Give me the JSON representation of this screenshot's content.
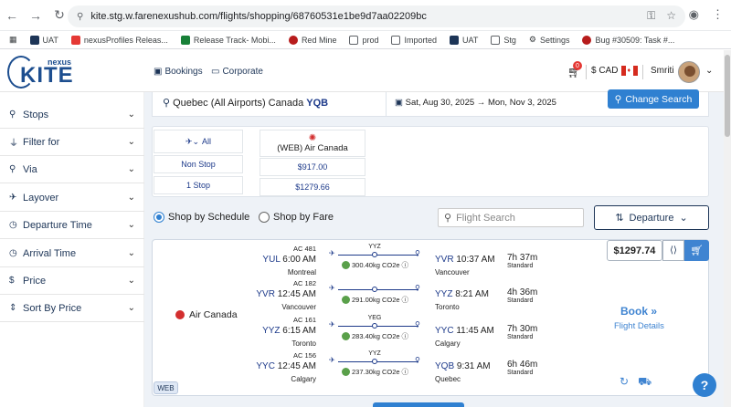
{
  "browser": {
    "url": "kite.stg.w.farenexushub.com/flights/shopping/68760531e1be9d7aa02209bc",
    "bookmarks": [
      "UAT",
      "nexusProfiles Releas...",
      "Release Track- Mobi...",
      "Red Mine",
      "prod",
      "Imported",
      "UAT",
      "Stg",
      "Settings",
      "Bug #30509: Task #..."
    ]
  },
  "logo": {
    "top": "nexus",
    "main": "KITE"
  },
  "header": {
    "bookings": "Bookings",
    "corporate": "Corporate",
    "cart_count": "0",
    "currency": "$ CAD",
    "user": "Smriti"
  },
  "sidebar": {
    "filters": [
      "Stops",
      "Filter for",
      "Via",
      "Layover",
      "Departure Time",
      "Arrival Time",
      "Price",
      "Sort By Price"
    ]
  },
  "summary": {
    "origin_label": "Quebec (All Airports) Canada",
    "origin_code": "YQB",
    "depart_date": "Sat, Aug 30, 2025",
    "return_date": "Mon, Nov 3, 2025",
    "change_search": "Change Search"
  },
  "matrix": {
    "all": "All",
    "airline": "(WEB) Air Canada",
    "non_stop": "Non Stop",
    "one_stop": "1 Stop",
    "non_stop_price": "$917.00",
    "one_stop_price": "$1279.66"
  },
  "controls": {
    "by_schedule": "Shop by Schedule",
    "by_fare": "Shop by Fare",
    "search_placeholder": "Flight Search",
    "sort": "Departure"
  },
  "result": {
    "airline": "Air Canada",
    "price": "$1297.74",
    "book": "Book",
    "details": "Flight Details",
    "web": "WEB",
    "segments": [
      {
        "flight": "AC 481",
        "from_code": "YUL",
        "dep": "6:00 AM",
        "from_city": "Montreal",
        "via": "YYZ",
        "co2": "300.40kg CO2e",
        "to_code": "YVR",
        "arr": "10:37 AM",
        "to_city": "Vancouver",
        "duration": "7h 37m",
        "class": "Standard"
      },
      {
        "flight": "AC 182",
        "from_code": "YVR",
        "dep": "12:45 AM",
        "from_city": "Vancouver",
        "via": "",
        "co2": "291.00kg CO2e",
        "to_code": "YYZ",
        "arr": "8:21 AM",
        "to_city": "Toronto",
        "duration": "4h 36m",
        "class": "Standard"
      },
      {
        "flight": "AC 161",
        "from_code": "YYZ",
        "dep": "6:15 AM",
        "from_city": "Toronto",
        "via": "YEG",
        "co2": "283.40kg CO2e",
        "to_code": "YYC",
        "arr": "11:45 AM",
        "to_city": "Calgary",
        "duration": "7h 30m",
        "class": "Standard"
      },
      {
        "flight": "AC 156",
        "from_code": "YYC",
        "dep": "12:45 AM",
        "from_city": "Calgary",
        "via": "YYZ",
        "co2": "237.30kg CO2e",
        "to_code": "YQB",
        "arr": "9:31 AM",
        "to_city": "Quebec",
        "duration": "6h 46m",
        "class": "Standard"
      }
    ]
  },
  "colors": {
    "brand": "#1d3557",
    "accent": "#2f80d1",
    "leaf": "#5aa04a",
    "air_canada": "#d32f2f"
  }
}
